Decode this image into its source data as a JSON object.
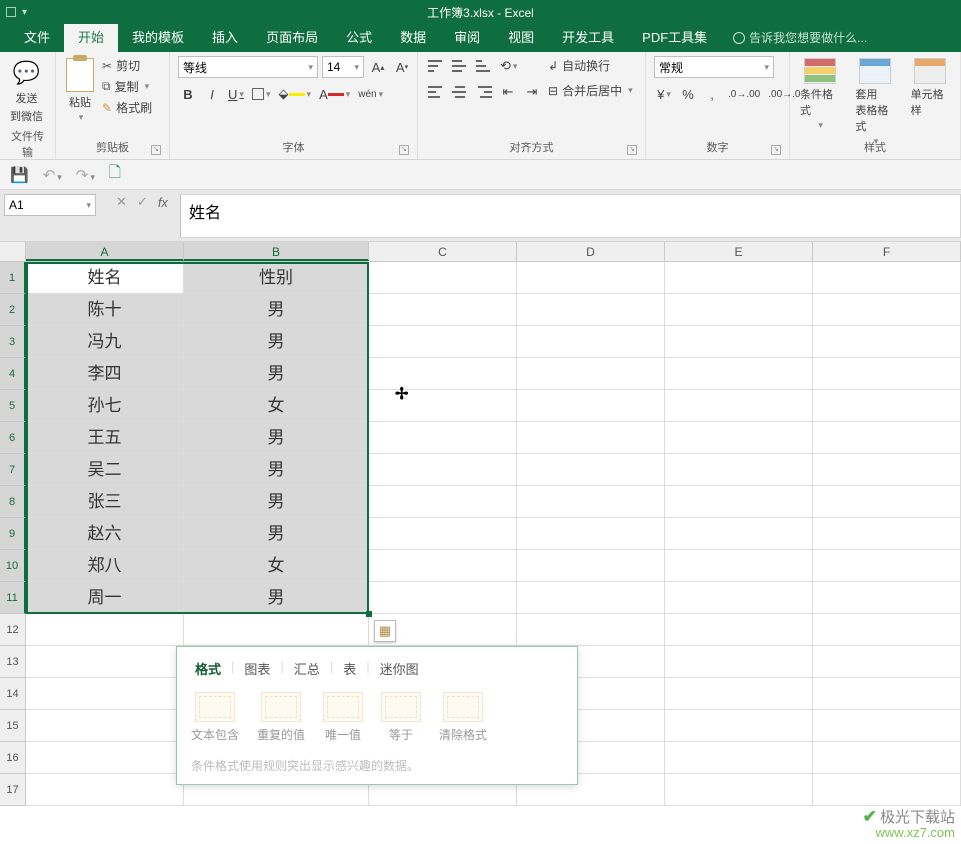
{
  "titlebar": {
    "title": "工作簿3.xlsx - Excel"
  },
  "tabs": {
    "file": "文件",
    "home": "开始",
    "templates": "我的模板",
    "insert": "插入",
    "layout": "页面布局",
    "formula": "公式",
    "data": "数据",
    "review": "审阅",
    "view": "视图",
    "dev": "开发工具",
    "pdf": "PDF工具集",
    "tellme": "告诉我您想要做什么..."
  },
  "ribbon": {
    "wechat": {
      "send": "发送",
      "to": "到微信",
      "group": "文件传输"
    },
    "clipboard": {
      "paste": "粘贴",
      "cut": "剪切",
      "copy": "复制",
      "format": "格式刷",
      "group": "剪贴板"
    },
    "font": {
      "name": "等线",
      "size": "14",
      "group": "字体",
      "wen": "wén"
    },
    "align": {
      "wrap": "自动换行",
      "merge": "合并后居中",
      "group": "对齐方式"
    },
    "number": {
      "format": "常规",
      "group": "数字"
    },
    "styles": {
      "cf": "条件格式",
      "tf": "套用\n表格格式",
      "cs": "单元格样",
      "group": "样式"
    }
  },
  "cellref": "A1",
  "formula_value": "姓名",
  "columns": [
    "A",
    "B",
    "C",
    "D",
    "E",
    "F"
  ],
  "rownums": [
    "1",
    "2",
    "3",
    "4",
    "5",
    "6",
    "7",
    "8",
    "9",
    "10",
    "11",
    "12",
    "13",
    "14",
    "15",
    "16",
    "17"
  ],
  "table": [
    {
      "name": "姓名",
      "gender": "性别"
    },
    {
      "name": "陈十",
      "gender": "男"
    },
    {
      "name": "冯九",
      "gender": "男"
    },
    {
      "name": "李四",
      "gender": "男"
    },
    {
      "name": "孙七",
      "gender": "女"
    },
    {
      "name": "王五",
      "gender": "男"
    },
    {
      "name": "吴二",
      "gender": "男"
    },
    {
      "name": "张三",
      "gender": "男"
    },
    {
      "name": "赵六",
      "gender": "男"
    },
    {
      "name": "郑八",
      "gender": "女"
    },
    {
      "name": "周一",
      "gender": "男"
    }
  ],
  "qa": {
    "tabs": {
      "format": "格式",
      "chart": "图表",
      "total": "汇总",
      "table": "表",
      "spark": "迷你图"
    },
    "items": {
      "text": "文本包含",
      "dup": "重复的值",
      "unique": "唯一值",
      "eq": "等于",
      "clear": "清除格式"
    },
    "hint": "条件格式使用规则突出显示感兴趣的数据。"
  },
  "watermark": {
    "cn": "极光下载站",
    "url": "www.xz7.com"
  }
}
